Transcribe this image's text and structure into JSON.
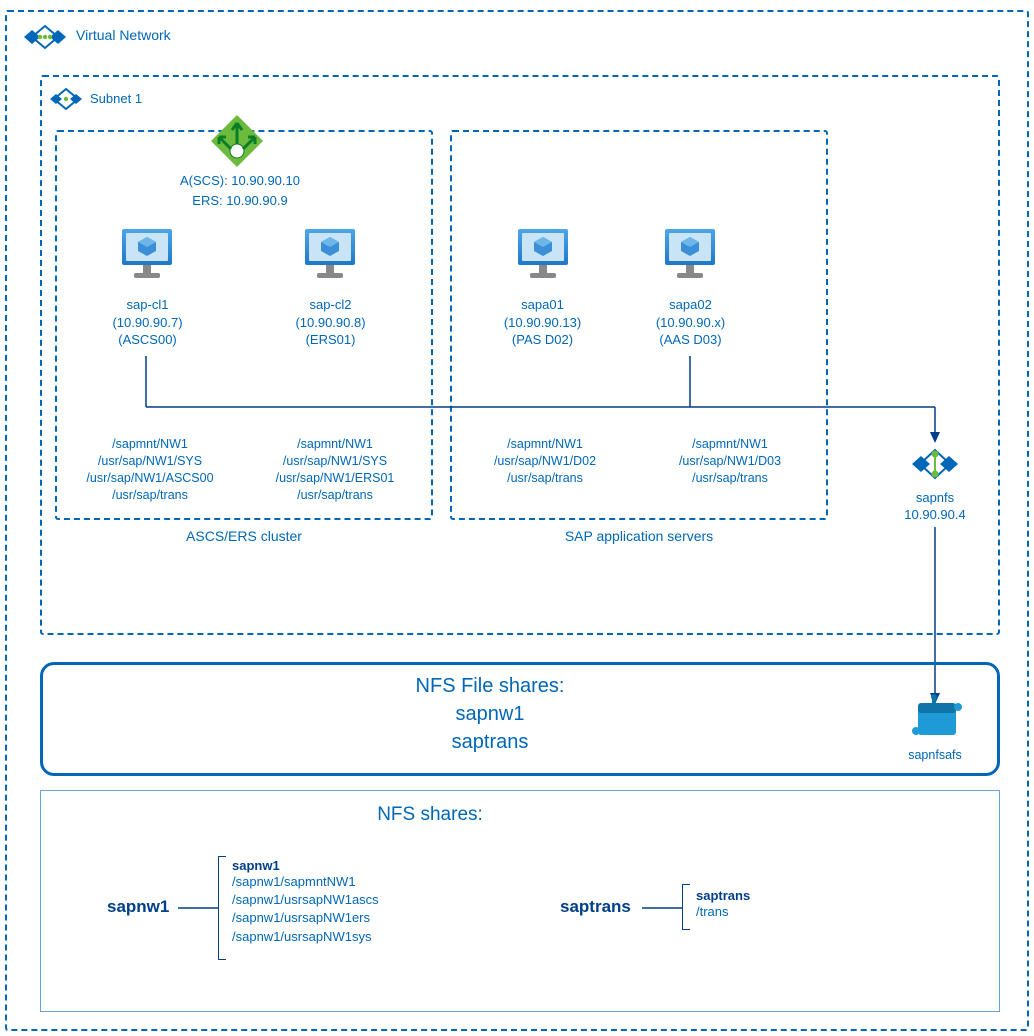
{
  "vnet": {
    "label": "Virtual Network"
  },
  "subnet": {
    "label": "Subnet 1"
  },
  "lb": {
    "ascs": "A(SCS): 10.90.90.10",
    "ers": "ERS: 10.90.90.9"
  },
  "vm1": {
    "name": "sap-cl1",
    "ip": "(10.90.90.7)",
    "role": "(ASCS00)"
  },
  "vm2": {
    "name": "sap-cl2",
    "ip": "(10.90.90.8)",
    "role": "(ERS01)"
  },
  "vm3": {
    "name": "sapa01",
    "ip": "(10.90.90.13)",
    "role": "(PAS D02)"
  },
  "vm4": {
    "name": "sapa02",
    "ip": "(10.90.90.x)",
    "role": "(AAS D03)"
  },
  "paths1": {
    "a": "/sapmnt/NW1",
    "b": "/usr/sap/NW1/SYS",
    "c": "/usr/sap/NW1/ASCS00",
    "d": "/usr/sap/trans"
  },
  "paths2": {
    "a": "/sapmnt/NW1",
    "b": "/usr/sap/NW1/SYS",
    "c": "/usr/sap/NW1/ERS01",
    "d": "/usr/sap/trans"
  },
  "paths3": {
    "a": "/sapmnt/NW1",
    "b": "/usr/sap/NW1/D02",
    "c": "/usr/sap/trans"
  },
  "paths4": {
    "a": "/sapmnt/NW1",
    "b": "/usr/sap/NW1/D03",
    "c": "/usr/sap/trans"
  },
  "cluster1": "ASCS/ERS cluster",
  "cluster2": "SAP application servers",
  "sapnfs": {
    "name": "sapnfs",
    "ip": "10.90.90.4"
  },
  "nfsbox": {
    "title": "NFS File shares:",
    "s1": "sapnw1",
    "s2": "saptrans"
  },
  "sapnfsafs": "sapnfsafs",
  "shares_title": "NFS shares:",
  "share1": {
    "name": "sapnw1",
    "title": "sapnw1",
    "p1": "/sapnw1/sapmntNW1",
    "p2": "/sapnw1/usrsapNW1ascs",
    "p3": "/sapnw1/usrsapNW1ers",
    "p4": "/sapnw1/usrsapNW1sys"
  },
  "share2": {
    "name": "saptrans",
    "title": "saptrans",
    "p1": "/trans"
  }
}
